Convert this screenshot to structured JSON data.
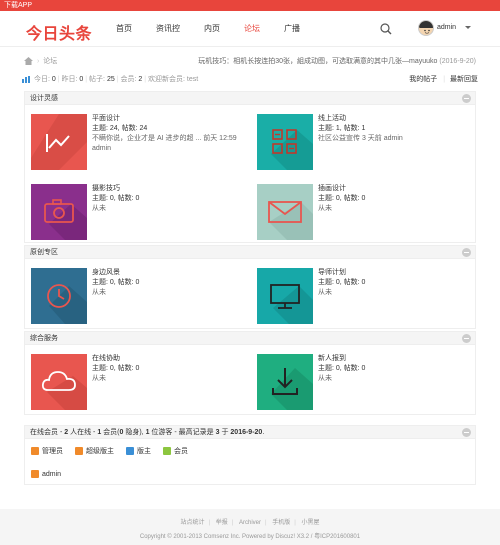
{
  "topbar": {
    "label": "下载APP"
  },
  "header": {
    "logo": "今日头条",
    "nav": [
      "首页",
      "资讯控",
      "内页",
      "论坛",
      "广播"
    ],
    "active_nav": "论坛",
    "user": "admin"
  },
  "crumb": {
    "label": "论坛"
  },
  "notice": {
    "text": "玩机技巧：相机长按连拍30张，組成动图，可选取满意的其中几张—mayuuko",
    "date": "(2016-9-20)"
  },
  "stats": {
    "today_label": "今日:",
    "today": "0",
    "yesterday_label": "昨日:",
    "yesterday": "0",
    "posts_label": "帖子:",
    "posts": "25",
    "members_label": "会员:",
    "members": "2",
    "welcome": "欢迎新会员: test",
    "my_posts": "我的帖子",
    "latest": "最新回复"
  },
  "sections": [
    {
      "title": "设计灵感",
      "forums": [
        {
          "name": "平面设计",
          "stats": "主题: 24, 帖数: 24",
          "last": "不瞒你说，企业才是 AI 进步的超 ... 前天 12:59",
          "last2": "admin",
          "color": "#e8564f",
          "icon": "chart-icon"
        },
        {
          "name": "线上活动",
          "stats": "主题: 1, 帖数: 1",
          "last": "社区公益宣传 3 天前 admin",
          "last2": "",
          "color": "#1aaea7",
          "icon": "calculator-icon"
        },
        {
          "name": "摄影技巧",
          "stats": "主题: 0, 帖数: 0",
          "last": "从未",
          "last2": "",
          "color": "#8a2f8c",
          "icon": "camera-icon"
        },
        {
          "name": "插画设计",
          "stats": "主题: 0, 帖数: 0",
          "last": "从未",
          "last2": "",
          "color": "#a7cfc5",
          "icon": "mail-icon"
        }
      ]
    },
    {
      "title": "原创专区",
      "forums": [
        {
          "name": "身边风景",
          "stats": "主题: 0, 帖数: 0",
          "last": "从未",
          "last2": "",
          "color": "#2f6e91",
          "icon": "clock-icon"
        },
        {
          "name": "导师计划",
          "stats": "主题: 0, 帖数: 0",
          "last": "从未",
          "last2": "",
          "color": "#17a8a8",
          "icon": "monitor-icon"
        }
      ]
    },
    {
      "title": "综合服务",
      "forums": [
        {
          "name": "在线协助",
          "stats": "主题: 0, 帖数: 0",
          "last": "从未",
          "last2": "",
          "color": "#e8564f",
          "icon": "cloud-icon"
        },
        {
          "name": "新人报到",
          "stats": "主题: 0, 帖数: 0",
          "last": "从未",
          "last2": "",
          "color": "#1fae80",
          "icon": "download-icon"
        }
      ]
    }
  ],
  "online": {
    "title_a": "在线会员 - ",
    "title_b": "2",
    "title_c": " 人在线 - ",
    "title_d": "1",
    "title_e": " 会员(",
    "title_f": "0",
    "title_g": " 隐身), ",
    "title_h": "1",
    "title_i": " 位游客 - 最高记录是 ",
    "title_j": "3",
    "title_k": " 于 ",
    "title_l": "2016-9-20",
    "title_m": ".",
    "legend": [
      {
        "label": "管理员",
        "color": "#f08a2a"
      },
      {
        "label": "超级版主",
        "color": "#f08a2a"
      },
      {
        "label": "版主",
        "color": "#3a8fd6"
      },
      {
        "label": "会员",
        "color": "#8cc63f"
      }
    ],
    "user": "admin"
  },
  "footer": {
    "links": [
      "站点统计",
      "举报",
      "Archiver",
      "手机版",
      "小黑屋"
    ],
    "copyright": "Copyright © 2001-2013 Comsenz Inc. Powered by Discuz! X3.2 / 粤ICP201600801"
  }
}
